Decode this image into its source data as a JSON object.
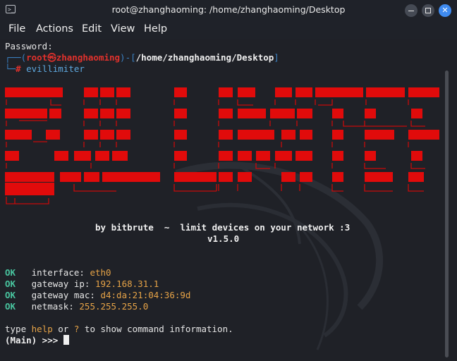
{
  "window": {
    "title": "root@zhanghaoming: /home/zhanghaoming/Desktop",
    "app_icon": "terminal-icon"
  },
  "menu": [
    "File",
    "Actions",
    "Edit",
    "View",
    "Help"
  ],
  "terminal": {
    "password_line": "Password:",
    "prompt": {
      "open": "┌──(",
      "user": "root",
      "at_symbol": "㉿",
      "host": "zhanghaoming",
      "mid": ")-[",
      "path": "/home/zhanghaoming/Desktop",
      "close": "]",
      "hash_prefix": "└─",
      "hash": "#",
      "command": "evillimiter"
    },
    "banner_word": "evillimiter",
    "tagline": "by bitbrute  ~  limit devices on your network :3",
    "version": "v1.5.0",
    "ok_lines": [
      {
        "status": "OK",
        "label": "interface:",
        "value": "eth0"
      },
      {
        "status": "OK",
        "label": "gateway ip:",
        "value": "192.168.31.1"
      },
      {
        "status": "OK",
        "label": "gateway mac:",
        "value": "d4:da:21:04:36:9d"
      },
      {
        "status": "OK",
        "label": "netmask:",
        "value": "255.255.255.0"
      }
    ],
    "hint": {
      "pre": "type ",
      "help": "help",
      "or": " or ",
      "q": "?",
      "post": " to show command information."
    },
    "input_prompt": "(Main) >>> "
  },
  "colors": {
    "banner_red": "#e10b0b",
    "ok_green": "#48c39e",
    "value_orange": "#e6a347",
    "prompt_blue": "#3b82c4",
    "prompt_red": "#e0312c"
  }
}
